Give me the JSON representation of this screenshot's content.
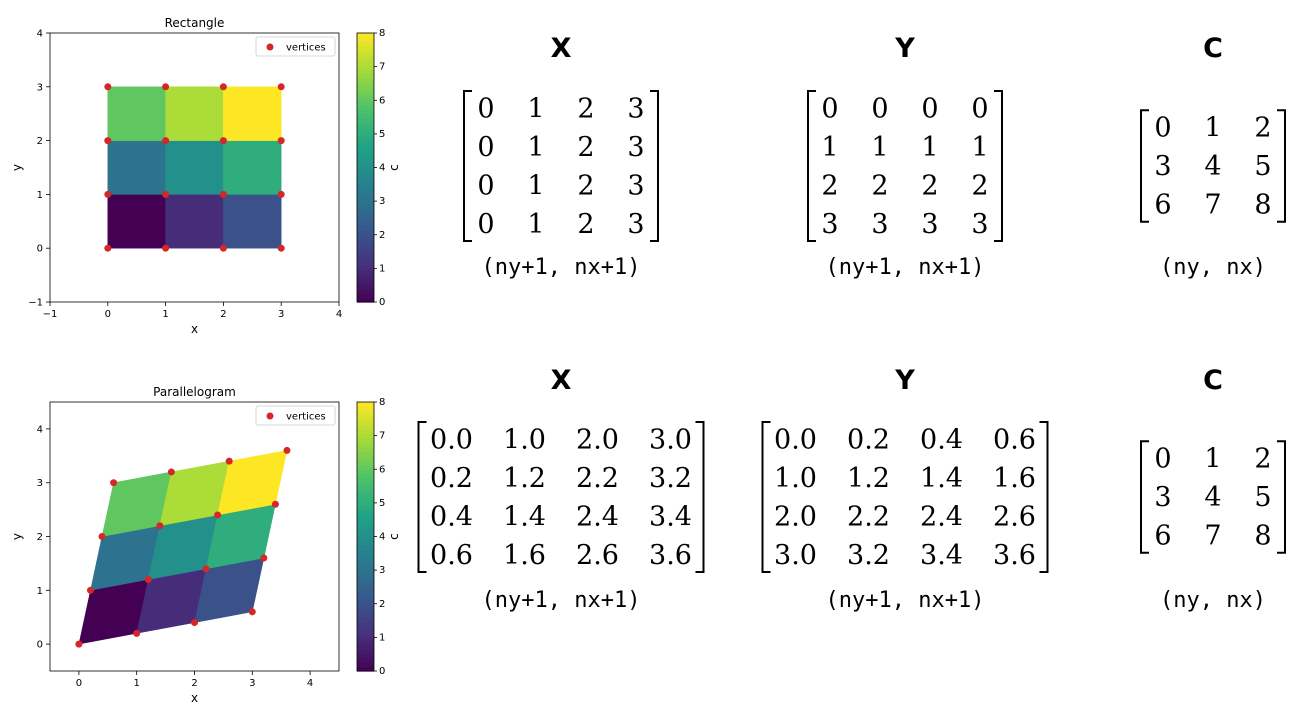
{
  "chart_data": [
    {
      "type": "heatmap",
      "title": "Rectangle",
      "xlabel": "x",
      "ylabel": "y",
      "xlim": [
        -1,
        4
      ],
      "ylim": [
        -1,
        4
      ],
      "xticks": [
        "−1",
        "0",
        "1",
        "2",
        "3",
        "4"
      ],
      "yticks": [
        "−1",
        "0",
        "1",
        "2",
        "3",
        "4"
      ],
      "legend": {
        "label": "vertices",
        "loc": "upper right"
      },
      "colorbar": {
        "label": "c",
        "range": [
          0,
          8
        ],
        "ticks": [
          "0",
          "1",
          "2",
          "3",
          "4",
          "5",
          "6",
          "7",
          "8"
        ],
        "colormap": "viridis"
      },
      "vertices_x": [
        [
          0,
          1,
          2,
          3
        ],
        [
          0,
          1,
          2,
          3
        ],
        [
          0,
          1,
          2,
          3
        ],
        [
          0,
          1,
          2,
          3
        ]
      ],
      "vertices_y": [
        [
          0,
          0,
          0,
          0
        ],
        [
          1,
          1,
          1,
          1
        ],
        [
          2,
          2,
          2,
          2
        ],
        [
          3,
          3,
          3,
          3
        ]
      ],
      "c": [
        [
          0,
          1,
          2
        ],
        [
          3,
          4,
          5
        ],
        [
          6,
          7,
          8
        ]
      ]
    },
    {
      "type": "heatmap",
      "title": "Parallelogram",
      "xlabel": "x",
      "ylabel": "y",
      "xlim": [
        -0.5,
        4.5
      ],
      "ylim": [
        -0.5,
        4.5
      ],
      "xticks": [
        "0",
        "1",
        "2",
        "3",
        "4"
      ],
      "yticks": [
        "0",
        "1",
        "2",
        "3",
        "4"
      ],
      "legend": {
        "label": "vertices",
        "loc": "upper right"
      },
      "colorbar": {
        "label": "c",
        "range": [
          0,
          8
        ],
        "ticks": [
          "0",
          "1",
          "2",
          "3",
          "4",
          "5",
          "6",
          "7",
          "8"
        ],
        "colormap": "viridis"
      },
      "vertices_x": [
        [
          0.0,
          1.0,
          2.0,
          3.0
        ],
        [
          0.2,
          1.2,
          2.2,
          3.2
        ],
        [
          0.4,
          1.4,
          2.4,
          3.4
        ],
        [
          0.6,
          1.6,
          2.6,
          3.6
        ]
      ],
      "vertices_y": [
        [
          0.0,
          0.2,
          0.4,
          0.6
        ],
        [
          1.0,
          1.2,
          1.4,
          1.6
        ],
        [
          2.0,
          2.2,
          2.4,
          2.6
        ],
        [
          3.0,
          3.2,
          3.4,
          3.6
        ]
      ],
      "c": [
        [
          0,
          1,
          2
        ],
        [
          3,
          4,
          5
        ],
        [
          6,
          7,
          8
        ]
      ]
    }
  ],
  "matrices": [
    {
      "row": 0,
      "items": [
        {
          "name": "X",
          "shape": "(ny+1, nx+1)",
          "rows": [
            [
              "0",
              "1",
              "2",
              "3"
            ],
            [
              "0",
              "1",
              "2",
              "3"
            ],
            [
              "0",
              "1",
              "2",
              "3"
            ],
            [
              "0",
              "1",
              "2",
              "3"
            ]
          ]
        },
        {
          "name": "Y",
          "shape": "(ny+1, nx+1)",
          "rows": [
            [
              "0",
              "0",
              "0",
              "0"
            ],
            [
              "1",
              "1",
              "1",
              "1"
            ],
            [
              "2",
              "2",
              "2",
              "2"
            ],
            [
              "3",
              "3",
              "3",
              "3"
            ]
          ]
        },
        {
          "name": "C",
          "shape": "(ny, nx)",
          "rows": [
            [
              "0",
              "1",
              "2"
            ],
            [
              "3",
              "4",
              "5"
            ],
            [
              "6",
              "7",
              "8"
            ]
          ]
        }
      ]
    },
    {
      "row": 1,
      "items": [
        {
          "name": "X",
          "shape": "(ny+1, nx+1)",
          "rows": [
            [
              "0.0",
              "1.0",
              "2.0",
              "3.0"
            ],
            [
              "0.2",
              "1.2",
              "2.2",
              "3.2"
            ],
            [
              "0.4",
              "1.4",
              "2.4",
              "3.4"
            ],
            [
              "0.6",
              "1.6",
              "2.6",
              "3.6"
            ]
          ]
        },
        {
          "name": "Y",
          "shape": "(ny+1, nx+1)",
          "rows": [
            [
              "0.0",
              "0.2",
              "0.4",
              "0.6"
            ],
            [
              "1.0",
              "1.2",
              "1.4",
              "1.6"
            ],
            [
              "2.0",
              "2.2",
              "2.4",
              "2.6"
            ],
            [
              "3.0",
              "3.2",
              "3.4",
              "3.6"
            ]
          ]
        },
        {
          "name": "C",
          "shape": "(ny, nx)",
          "rows": [
            [
              "0",
              "1",
              "2"
            ],
            [
              "3",
              "4",
              "5"
            ],
            [
              "6",
              "7",
              "8"
            ]
          ]
        }
      ]
    }
  ],
  "colors": {
    "viridis": [
      "#440154",
      "#46327e",
      "#365c8d",
      "#277f8e",
      "#1fa187",
      "#4ac16d",
      "#a0da39",
      "#fde725"
    ],
    "vertex": "#d62728"
  }
}
